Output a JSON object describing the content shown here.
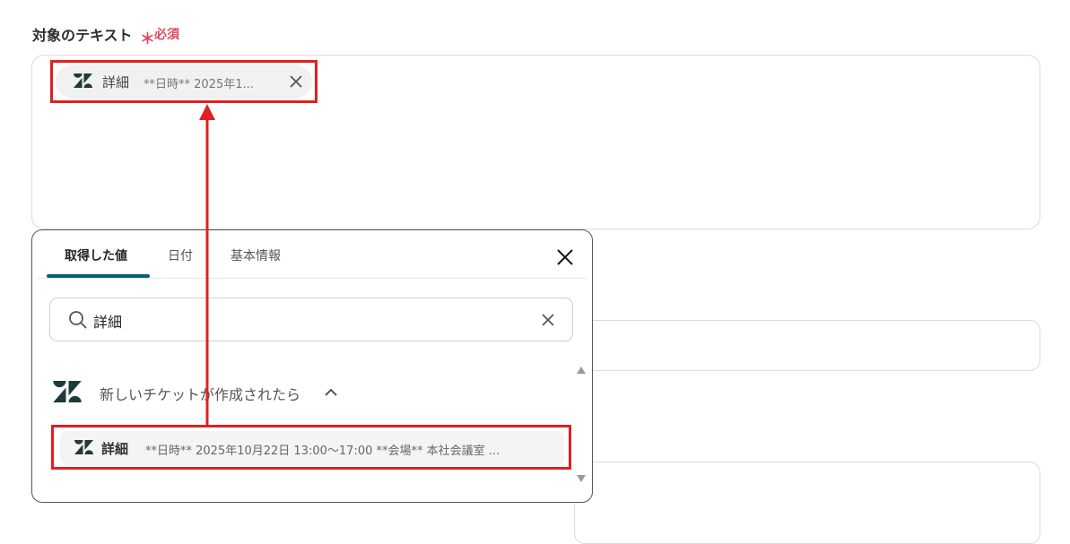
{
  "field": {
    "label": "対象のテキスト",
    "required_mark": "＊",
    "required_text": "必須"
  },
  "chip": {
    "name": "詳細",
    "value": "**日時** 2025年1..."
  },
  "popup": {
    "tabs": [
      {
        "label": "取得した値"
      },
      {
        "label": "日付"
      },
      {
        "label": "基本情報"
      }
    ],
    "search": {
      "value": "詳細"
    },
    "group": {
      "label": "新しいチケットが作成されたら"
    },
    "item": {
      "name": "詳細",
      "value": "**日時** 2025年10月22日 13:00～17:00 **会場** 本社会議室 ..."
    }
  },
  "colors": {
    "highlight": "#e02020",
    "accent": "#0c5d73",
    "required": "#e2475a"
  },
  "icons": [
    "zendesk-logo-icon",
    "close-icon",
    "search-icon",
    "chevron-up-icon",
    "scroll-up-icon",
    "scroll-down-icon"
  ]
}
